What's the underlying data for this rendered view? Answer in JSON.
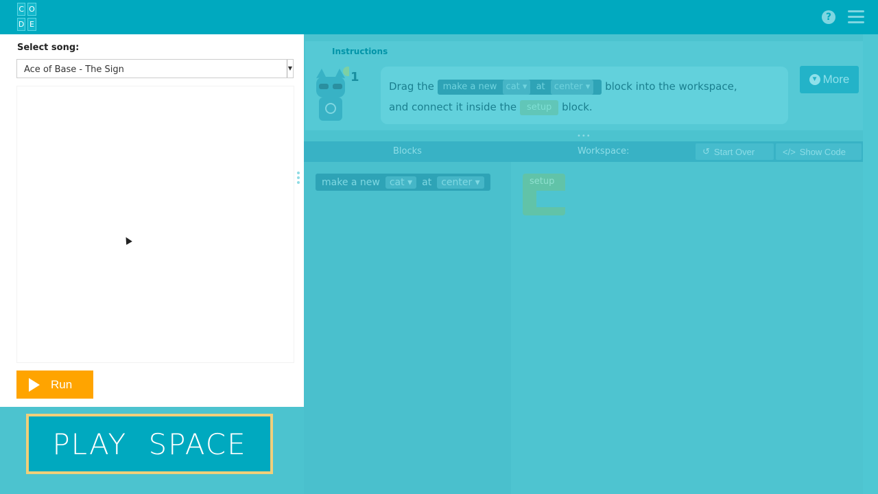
{
  "header": {
    "logo_letters": [
      "C",
      "O",
      "",
      "D",
      "E",
      ""
    ],
    "help_icon": "question-circle-icon",
    "menu_icon": "hamburger-menu-icon"
  },
  "left_panel": {
    "select_label": "Select song:",
    "selected_song": "Ace of Base - The Sign",
    "run_label": "Run",
    "banner_text": "PLAY SPACE"
  },
  "instructions": {
    "tab_label": "Instructions",
    "hint_count": "1",
    "text_before": "Drag the",
    "block_make": "make a new",
    "block_cat": "cat",
    "block_at": "at",
    "block_center": "center",
    "text_middle": "block into the workspace,",
    "text_connect": "and connect it inside the",
    "block_setup": "setup",
    "text_after": "block.",
    "more_label": "More"
  },
  "toolbar": {
    "blocks_label": "Blocks",
    "workspace_label": "Workspace:",
    "start_over_label": "Start Over",
    "show_code_label": "Show Code"
  },
  "toolbox_block": {
    "make": "make a new",
    "sprite": "cat",
    "at": "at",
    "location": "center"
  },
  "workspace_block": {
    "label": "setup"
  },
  "colors": {
    "header": "#00a9bf",
    "run_button": "#ffa400",
    "banner_border": "#f0cf7a",
    "overlay": "#4cc3cf"
  }
}
